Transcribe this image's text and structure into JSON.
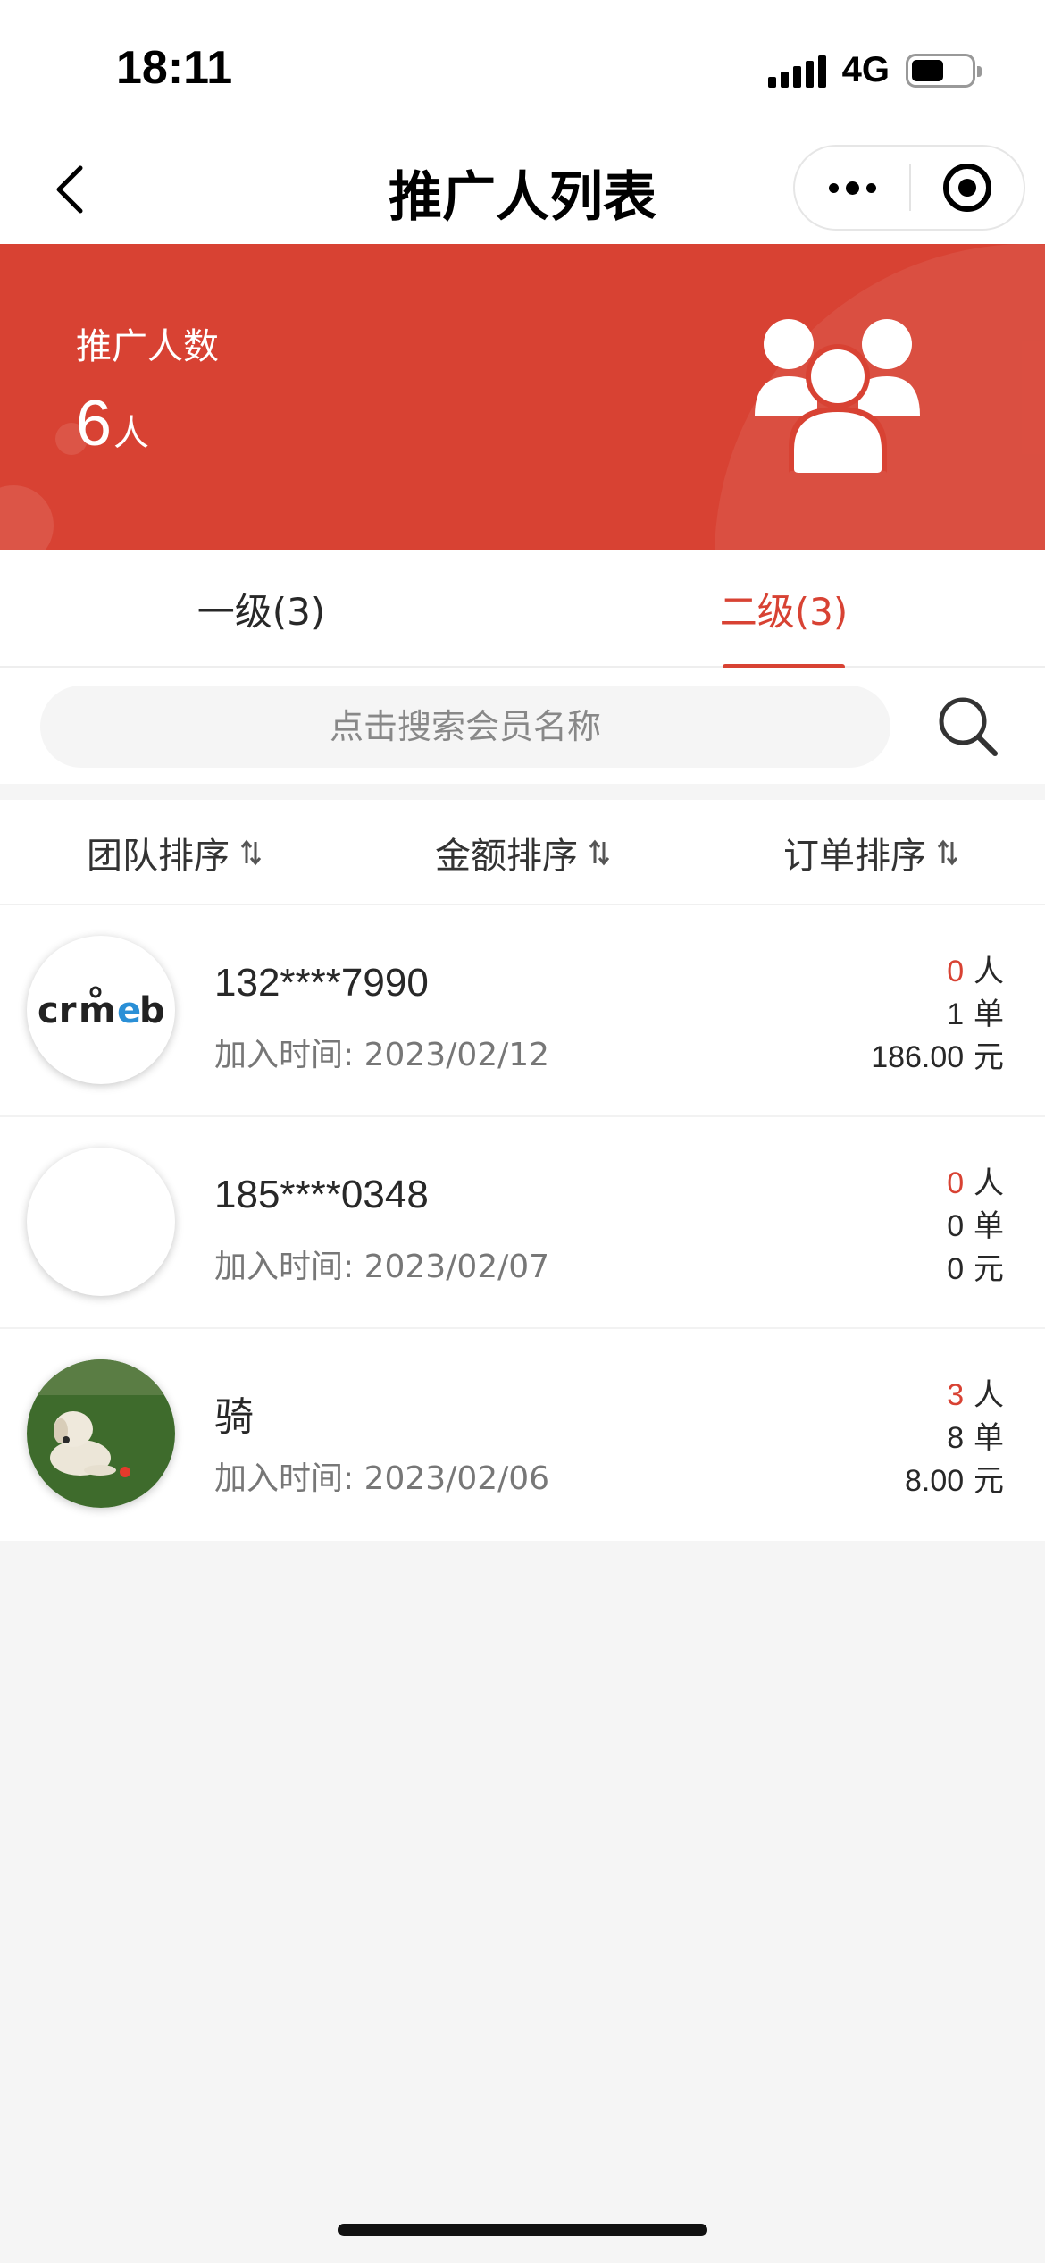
{
  "status_bar": {
    "time": "18:11",
    "network": "4G",
    "battery_level": 0.55
  },
  "nav": {
    "title": "推广人列表",
    "icons": {
      "back": "chevron-left-icon",
      "more": "more-dots-icon",
      "close": "target-circle-icon"
    }
  },
  "banner": {
    "label": "推广人数",
    "count": "6",
    "unit": "人",
    "icon": "group-people-icon",
    "color": "#d84233"
  },
  "tabs": [
    {
      "label": "一级(3)",
      "active": false
    },
    {
      "label": "二级(3)",
      "active": true
    }
  ],
  "search": {
    "placeholder": "点击搜索会员名称",
    "icon": "search-icon"
  },
  "sort": [
    {
      "label": "团队排序"
    },
    {
      "label": "金额排序"
    },
    {
      "label": "订单排序"
    }
  ],
  "members": [
    {
      "name": "132****7990",
      "join_label": "加入时间: ",
      "join_date": "2023/02/12",
      "people": "0",
      "people_unit": "人",
      "orders": "1",
      "orders_unit": "单",
      "amount": "186.00",
      "amount_unit": "元",
      "avatar": "crmeb-logo-avatar"
    },
    {
      "name": "185****0348",
      "join_label": "加入时间: ",
      "join_date": "2023/02/07",
      "people": "0",
      "people_unit": "人",
      "orders": "0",
      "orders_unit": "单",
      "amount": "0",
      "amount_unit": "元",
      "avatar": "blank-avatar"
    },
    {
      "name": "骑",
      "join_label": "加入时间: ",
      "join_date": "2023/02/06",
      "people": "3",
      "people_unit": "人",
      "orders": "8",
      "orders_unit": "单",
      "amount": "8.00",
      "amount_unit": "元",
      "avatar": "dog-photo-avatar"
    }
  ]
}
